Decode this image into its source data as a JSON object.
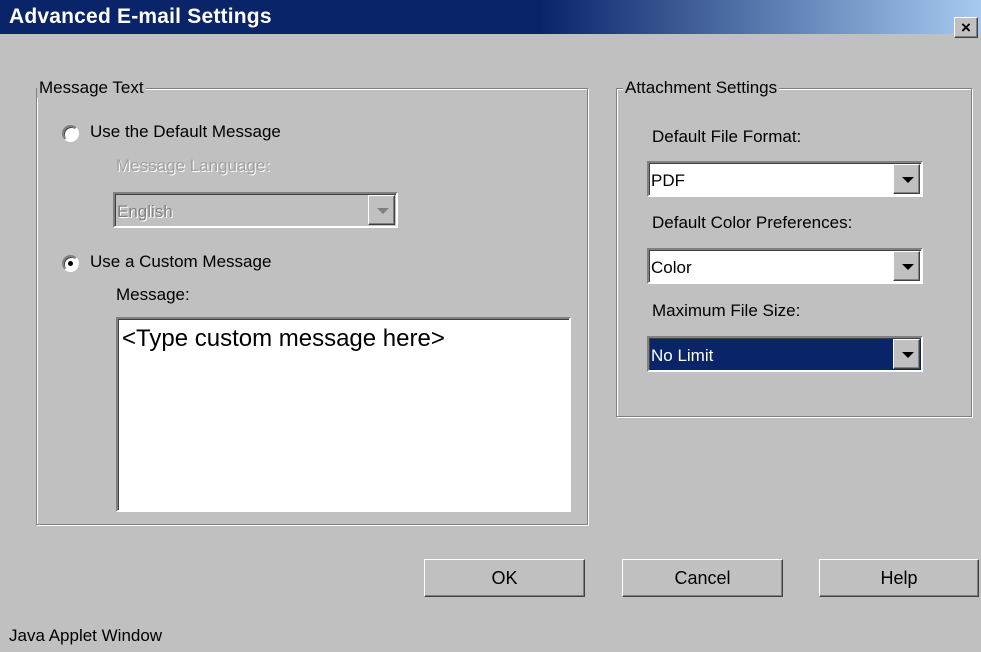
{
  "window": {
    "title": "Advanced E-mail Settings",
    "close_glyph": "×"
  },
  "message_text": {
    "legend": "Message Text",
    "default_option": {
      "label": "Use the Default Message",
      "checked": false
    },
    "language_label": "Message Language:",
    "language_value": "English",
    "custom_option": {
      "label": "Use a Custom Message",
      "checked": true
    },
    "message_label": "Message:",
    "message_value": "<Type custom message here>"
  },
  "attachment": {
    "legend": "Attachment Settings",
    "file_format_label": "Default File Format:",
    "file_format_value": "PDF",
    "color_label": "Default Color Preferences:",
    "color_value": "Color",
    "size_label": "Maximum File Size:",
    "size_value": "No Limit"
  },
  "buttons": {
    "ok": "OK",
    "cancel": "Cancel",
    "help": "Help"
  },
  "status": "Java Applet Window",
  "colors": {
    "titlebar": "#0a246a",
    "face": "#c0c0c0",
    "selection": "#0a246a"
  },
  "icons": {
    "close": "close-icon",
    "dropdown": "chevron-down-icon",
    "radio": "radio-icon"
  }
}
